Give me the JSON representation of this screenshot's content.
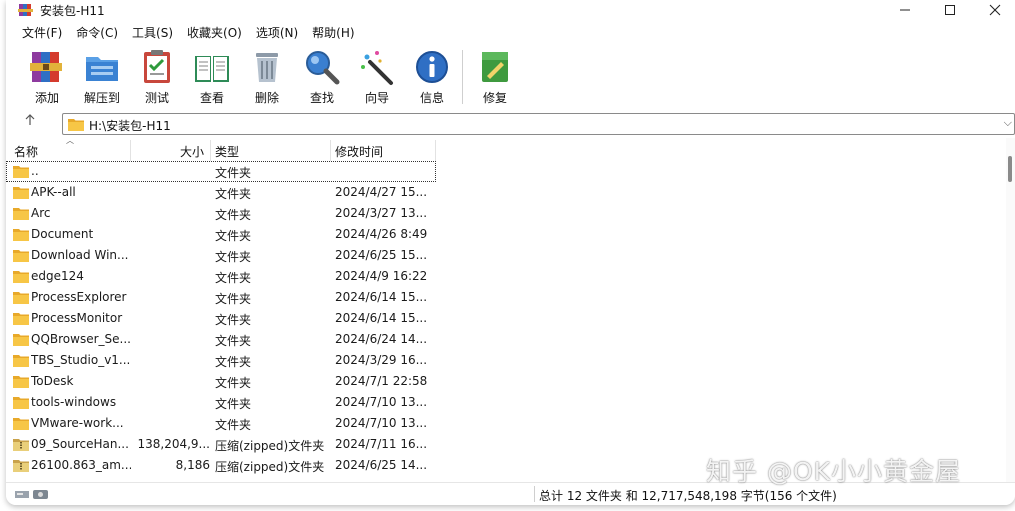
{
  "window": {
    "title": "安装包-H11"
  },
  "menu": [
    "文件(F)",
    "命令(C)",
    "工具(S)",
    "收藏夹(O)",
    "选项(N)",
    "帮助(H)"
  ],
  "toolbar": [
    {
      "label": "添加",
      "icon": "add-archive-icon"
    },
    {
      "label": "解压到",
      "icon": "extract-to-icon"
    },
    {
      "label": "测试",
      "icon": "test-clipboard-icon"
    },
    {
      "label": "查看",
      "icon": "view-book-icon"
    },
    {
      "label": "删除",
      "icon": "trash-icon"
    },
    {
      "label": "查找",
      "icon": "magnifier-icon"
    },
    {
      "label": "向导",
      "icon": "wizard-wand-icon"
    },
    {
      "label": "信息",
      "icon": "info-icon"
    },
    {
      "label": "修复",
      "icon": "repair-box-icon"
    }
  ],
  "address": {
    "path": "H:\\安装包-H11"
  },
  "columns": {
    "name": "名称",
    "size": "大小",
    "type": "类型",
    "modified": "修改时间"
  },
  "files": [
    {
      "name": "..",
      "size": "",
      "type": "文件夹",
      "modified": "",
      "icon": "folder-icon"
    },
    {
      "name": "APK--all",
      "size": "",
      "type": "文件夹",
      "modified": "2024/4/27 15...",
      "icon": "folder-icon"
    },
    {
      "name": "Arc",
      "size": "",
      "type": "文件夹",
      "modified": "2024/3/27 13...",
      "icon": "folder-icon"
    },
    {
      "name": "Document",
      "size": "",
      "type": "文件夹",
      "modified": "2024/4/26 8:49",
      "icon": "folder-icon"
    },
    {
      "name": "Download Win...",
      "size": "",
      "type": "文件夹",
      "modified": "2024/6/25 15...",
      "icon": "folder-icon"
    },
    {
      "name": "edge124",
      "size": "",
      "type": "文件夹",
      "modified": "2024/4/9 16:22",
      "icon": "folder-icon"
    },
    {
      "name": "ProcessExplorer",
      "size": "",
      "type": "文件夹",
      "modified": "2024/6/14 15...",
      "icon": "folder-icon"
    },
    {
      "name": "ProcessMonitor",
      "size": "",
      "type": "文件夹",
      "modified": "2024/6/14 15...",
      "icon": "folder-icon"
    },
    {
      "name": "QQBrowser_Se...",
      "size": "",
      "type": "文件夹",
      "modified": "2024/6/24 14...",
      "icon": "folder-icon"
    },
    {
      "name": "TBS_Studio_v1....",
      "size": "",
      "type": "文件夹",
      "modified": "2024/3/29 16...",
      "icon": "folder-icon"
    },
    {
      "name": "ToDesk",
      "size": "",
      "type": "文件夹",
      "modified": "2024/7/1 22:58",
      "icon": "folder-icon"
    },
    {
      "name": "tools-windows",
      "size": "",
      "type": "文件夹",
      "modified": "2024/7/10 13...",
      "icon": "folder-icon"
    },
    {
      "name": "VMware-work...",
      "size": "",
      "type": "文件夹",
      "modified": "2024/7/10 13...",
      "icon": "folder-icon"
    },
    {
      "name": "09_SourceHan...",
      "size": "138,204,9...",
      "type": "压缩(zipped)文件夹",
      "modified": "2024/7/11 16...",
      "icon": "zip-folder-icon"
    },
    {
      "name": "26100.863_am...",
      "size": "8,186",
      "type": "压缩(zipped)文件夹",
      "modified": "2024/6/25 14...",
      "icon": "zip-folder-icon"
    }
  ],
  "status": {
    "summary": "总计 12 文件夹 和 12,717,548,198 字节(156 个文件)"
  },
  "watermark": "知乎 @OK小小黄金屋"
}
